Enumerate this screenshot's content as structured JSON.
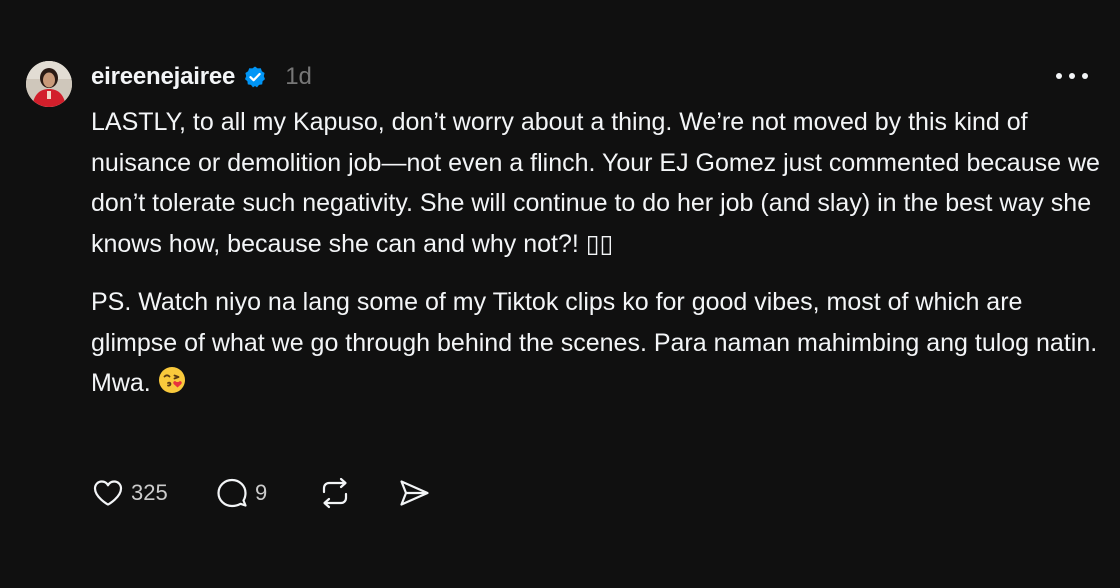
{
  "post": {
    "username": "eireenejairee",
    "timestamp": "1d",
    "paragraphs": [
      "LASTLY, to all my Kapuso, don’t worry about a thing. We’re not moved by this kind of nuisance or demolition job—not even a flinch. Your EJ Gomez just commented because we don’t tolerate such negativity. She will continue to do her job (and slay) in the best way she knows how, because she can and why not?! ▯▯",
      "PS. Watch niyo na lang some of my Tiktok clips ko for good vibes, most of which are glimpse of what we go through behind the scenes. Para naman mahimbing ang tulog natin. Mwa."
    ],
    "emoji": "face-blowing-a-kiss",
    "likes": "325",
    "replies": "9"
  },
  "icons": {
    "verified": "verified-badge-icon",
    "more": "more-dots-icon",
    "like": "heart-icon",
    "reply": "comment-bubble-icon",
    "repost": "repost-icon",
    "share": "send-icon"
  },
  "colors": {
    "background": "#101010",
    "text": "#f3f5f7",
    "muted": "#777777",
    "verified": "#0095f6"
  }
}
